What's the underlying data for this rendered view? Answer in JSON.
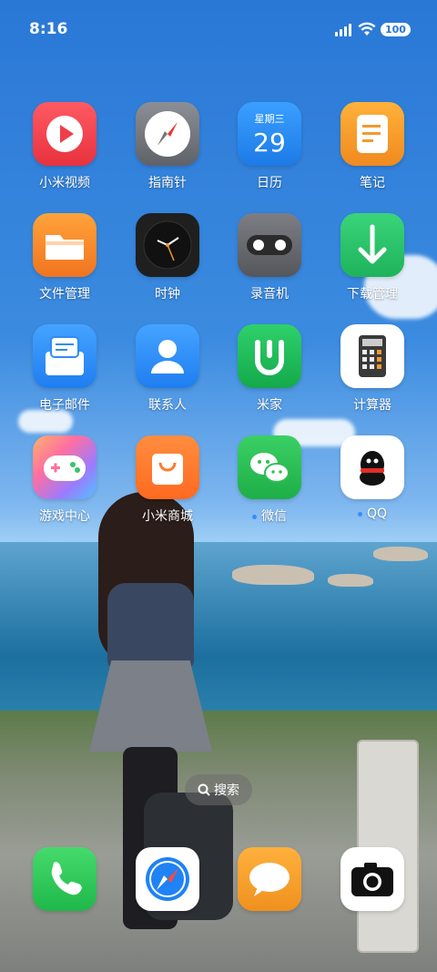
{
  "status": {
    "time": "8:16",
    "battery": "100"
  },
  "apps": [
    {
      "label": "小米视频",
      "icon": "play-video-icon",
      "color": "#f0454f"
    },
    {
      "label": "指南针",
      "icon": "compass-icon",
      "color": "#7c7f86"
    },
    {
      "label": "日历",
      "icon": "calendar-icon",
      "color": "#2a8bf2",
      "weekday": "星期三",
      "day": "29"
    },
    {
      "label": "笔记",
      "icon": "note-icon",
      "color": "#f39a2c"
    },
    {
      "label": "文件管理",
      "icon": "folder-icon",
      "color": "#f58b26"
    },
    {
      "label": "时钟",
      "icon": "clock-icon",
      "color": "#222222"
    },
    {
      "label": "录音机",
      "icon": "recorder-icon",
      "color": "#6b6d72"
    },
    {
      "label": "下载管理",
      "icon": "download-icon",
      "color": "#27c46a"
    },
    {
      "label": "电子邮件",
      "icon": "email-icon",
      "color": "#2f8df3"
    },
    {
      "label": "联系人",
      "icon": "contacts-icon",
      "color": "#2d8ef5"
    },
    {
      "label": "米家",
      "icon": "mihome-icon",
      "color": "#1fbb5a"
    },
    {
      "label": "计算器",
      "icon": "calculator-icon",
      "color": "#ffffff"
    },
    {
      "label": "游戏中心",
      "icon": "game-controller-icon",
      "color": "#b86de8"
    },
    {
      "label": "小米商城",
      "icon": "shopping-bag-icon",
      "color": "#ff7a2f"
    },
    {
      "label": "微信",
      "icon": "wechat-icon",
      "color": "#2dbf55",
      "dot": true
    },
    {
      "label": "QQ",
      "icon": "qq-penguin-icon",
      "color": "#ffffff",
      "dot": true
    }
  ],
  "search": {
    "label": "搜索"
  },
  "dock": [
    {
      "icon": "phone-icon",
      "color": "#2fcf59"
    },
    {
      "icon": "browser-icon",
      "color": "#ffffff"
    },
    {
      "icon": "messages-icon",
      "color": "#f3a028"
    },
    {
      "icon": "camera-icon",
      "color": "#ffffff"
    }
  ]
}
